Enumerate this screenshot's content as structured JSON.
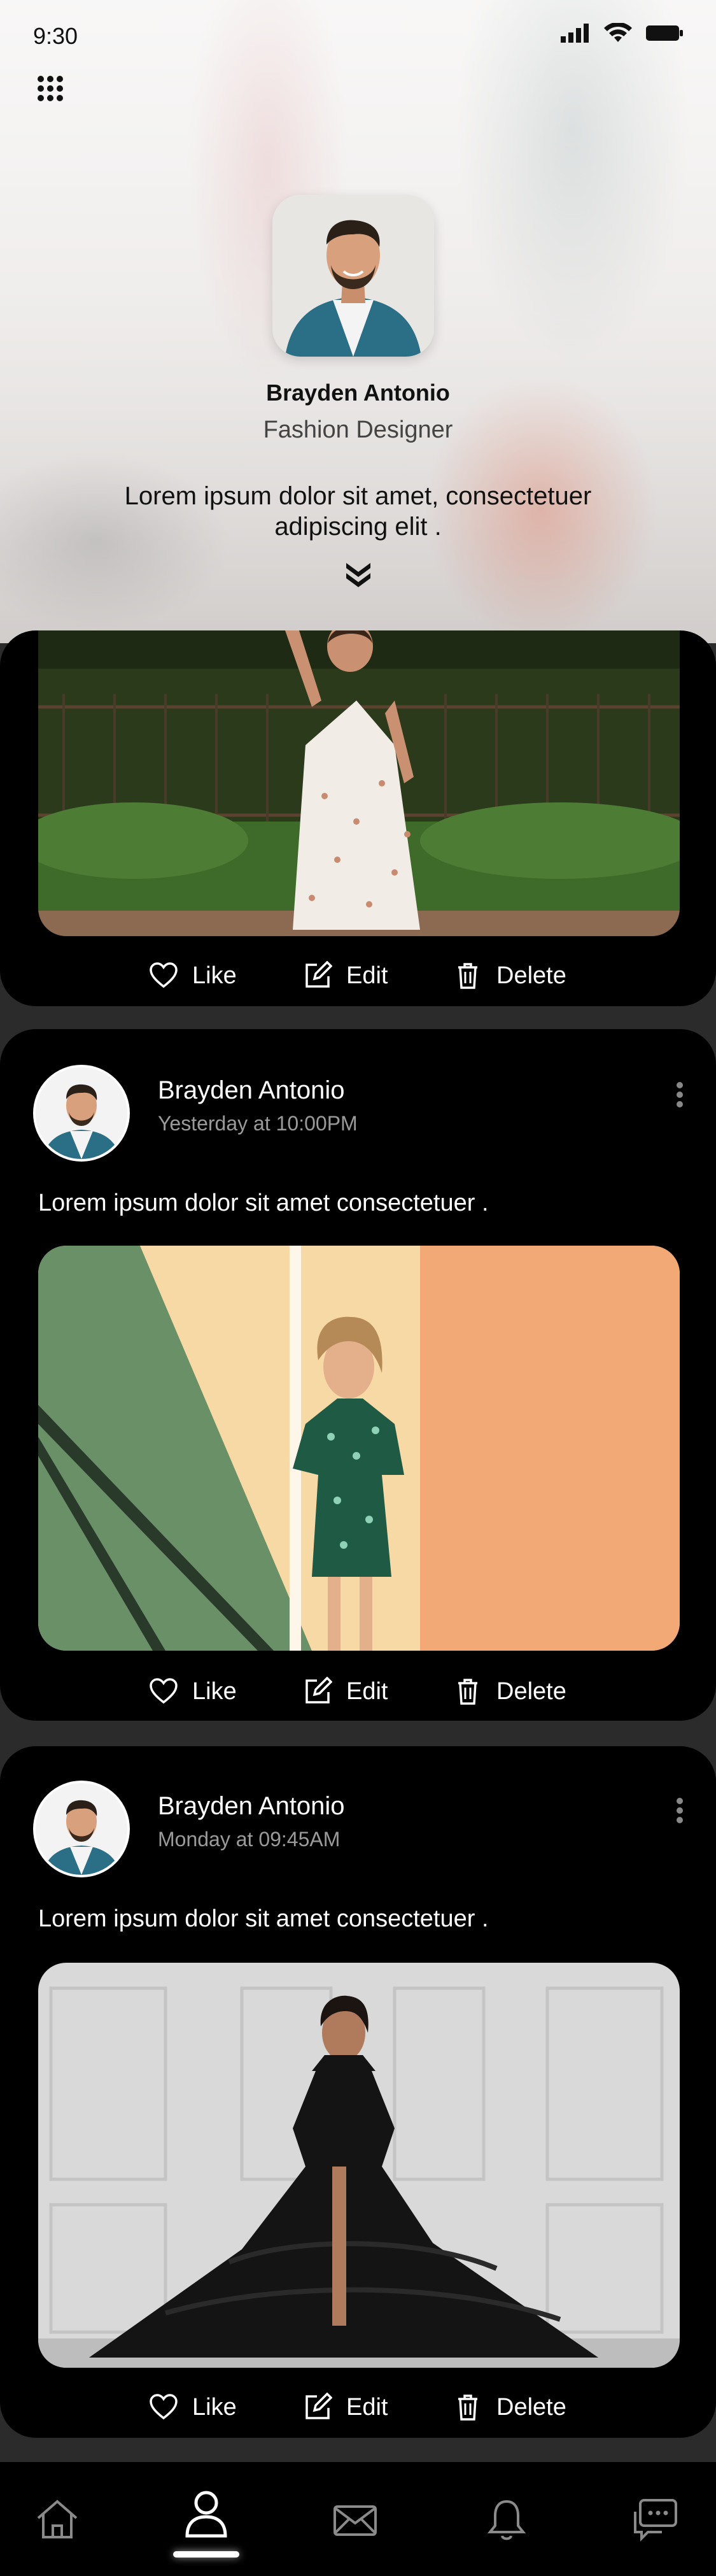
{
  "status_bar": {
    "time": "9:30"
  },
  "profile": {
    "name": "Brayden Antonio",
    "role": "Fashion Designer",
    "bio": "Lorem ipsum dolor sit amet, consectetuer adipiscing elit ."
  },
  "actions": {
    "like": "Like",
    "edit": "Edit",
    "delete": "Delete"
  },
  "posts": [
    {
      "author": "Brayden Antonio",
      "time": "Yesterday at 10:00PM",
      "text": "Lorem ipsum dolor sit amet consectetuer ."
    },
    {
      "author": "Brayden Antonio",
      "time": "Monday at 09:45AM",
      "text": "Lorem ipsum dolor sit amet consectetuer ."
    }
  ],
  "nav": {
    "items": [
      "home-icon",
      "profile-icon",
      "mail-icon",
      "bell-icon",
      "chat-icon"
    ],
    "active": "profile-icon"
  },
  "colors": {
    "card_bg": "#000000",
    "text_primary": "#ffffff",
    "text_secondary": "#9a9a9a"
  }
}
